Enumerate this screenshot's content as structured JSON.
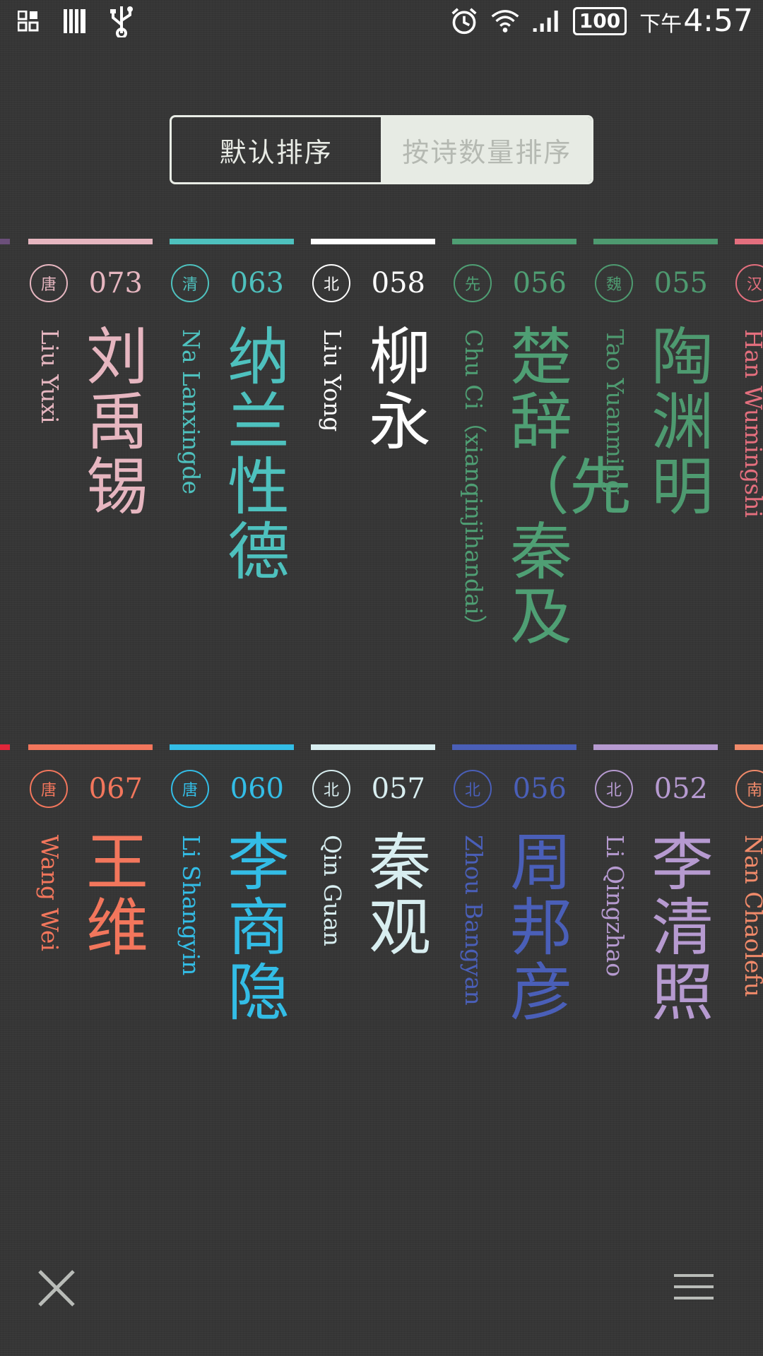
{
  "status_bar": {
    "time": "4:57",
    "ampm": "下午",
    "battery": "100"
  },
  "sort_toggle": {
    "default_label": "默认排序",
    "by_count_label": "按诗数量排序"
  },
  "row1": [
    {
      "dynasty": "唐",
      "count": "073",
      "pinyin": "Liu Yuxi",
      "name": "刘禹锡",
      "color": "#e6b6c0"
    },
    {
      "dynasty": "清",
      "count": "063",
      "pinyin": "Na Lanxingde",
      "name": "纳兰性德",
      "color": "#4ec1be"
    },
    {
      "dynasty": "北",
      "count": "058",
      "pinyin": "Liu Yong",
      "name": "柳永",
      "color": "#ffffff"
    },
    {
      "dynasty": "先",
      "count": "056",
      "pinyin": "Chu Ci（xianqinjihandai）",
      "name": "楚辞（先秦及",
      "color": "#4f9f74"
    },
    {
      "dynasty": "魏",
      "count": "055",
      "pinyin": "Tao Yuanming",
      "name": "陶渊明",
      "color": "#4e9a70"
    },
    {
      "dynasty": "汉",
      "count": "",
      "pinyin": "Han Wumingshi",
      "name": "",
      "color": "#e46f7e"
    }
  ],
  "row2": [
    {
      "dynasty": "唐",
      "count": "067",
      "pinyin": "Wang Wei",
      "name": "王维",
      "color": "#f2765c"
    },
    {
      "dynasty": "唐",
      "count": "060",
      "pinyin": "Li Shangyin",
      "name": "李商隐",
      "color": "#33bde6"
    },
    {
      "dynasty": "北",
      "count": "057",
      "pinyin": "Qin Guan",
      "name": "秦观",
      "color": "#d8eef0"
    },
    {
      "dynasty": "北",
      "count": "056",
      "pinyin": "Zhou Bangyan",
      "name": "周邦彦",
      "color": "#4a5fb8"
    },
    {
      "dynasty": "北",
      "count": "052",
      "pinyin": "Li Qingzhao",
      "name": "李清照",
      "color": "#b69ad0"
    },
    {
      "dynasty": "南",
      "count": "",
      "pinyin": "Nan Chaolefu",
      "name": "",
      "color": "#f08a6a"
    }
  ]
}
